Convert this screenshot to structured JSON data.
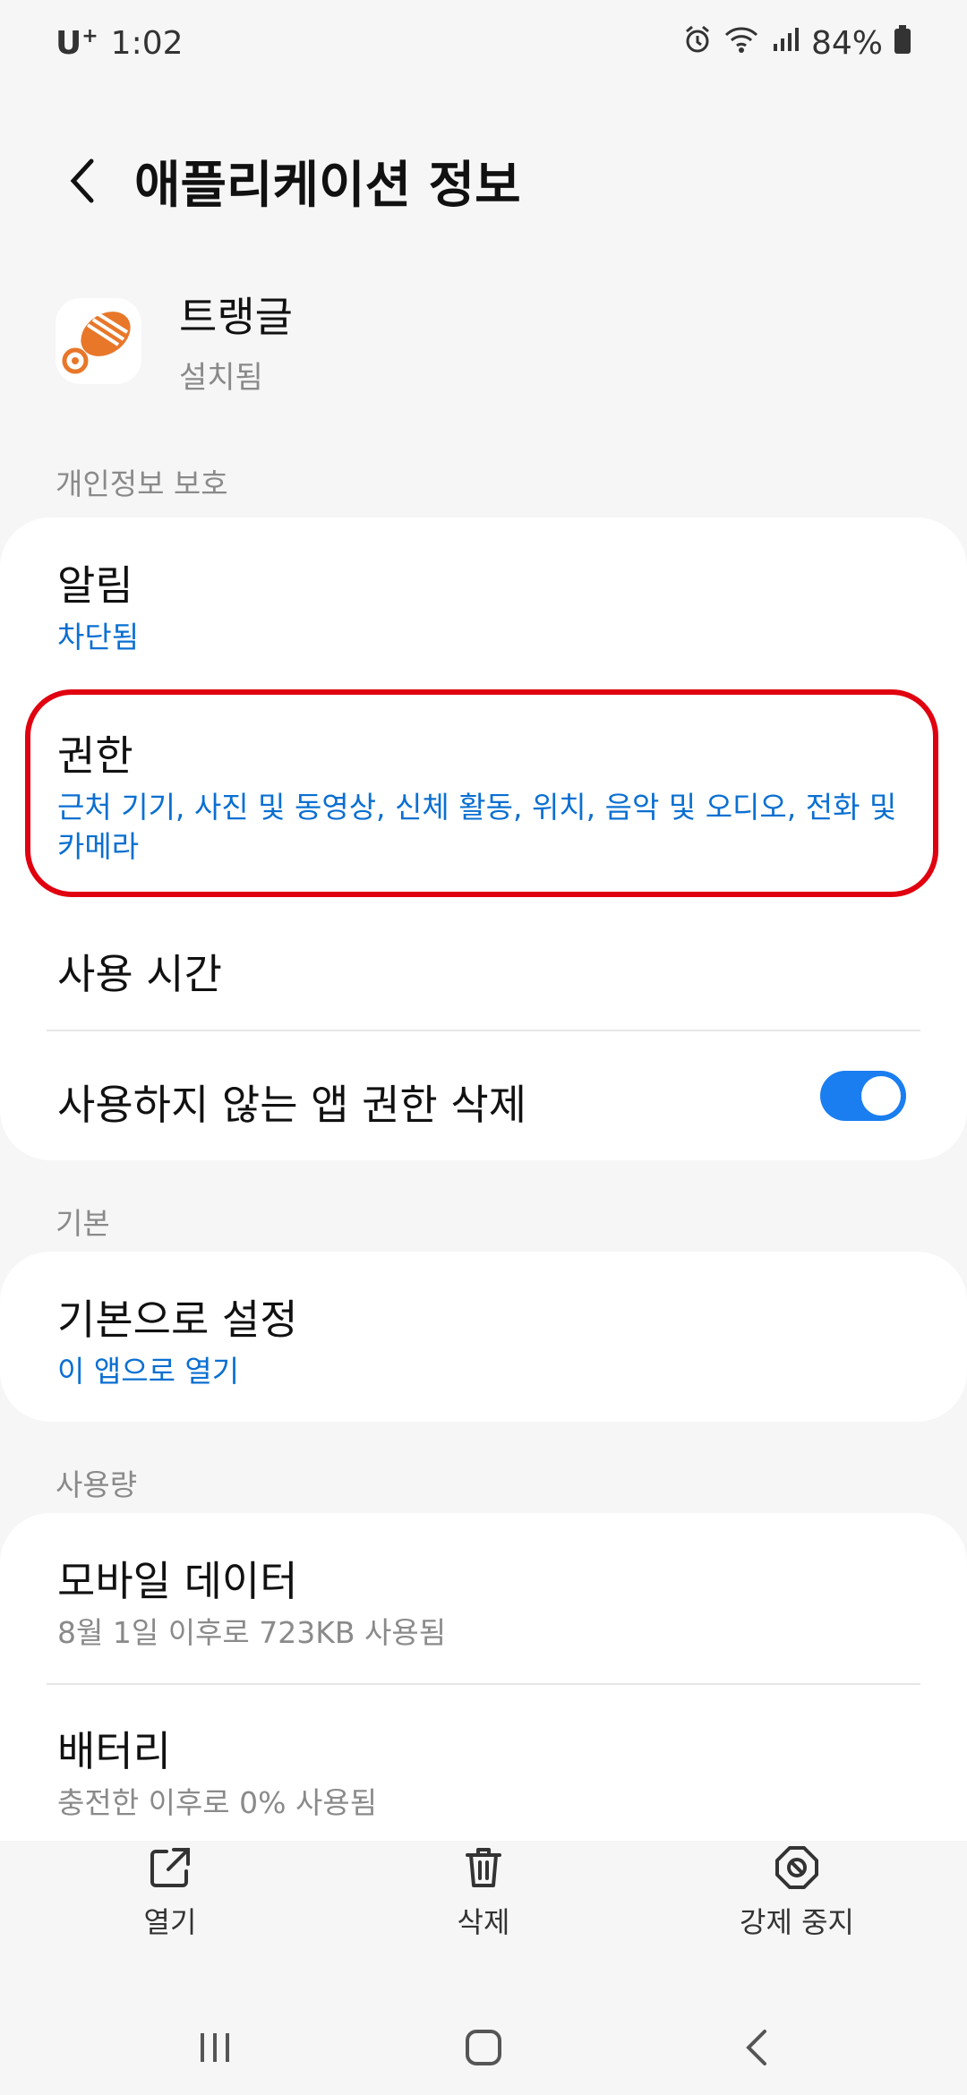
{
  "status_bar": {
    "carrier": "U",
    "carrier_sup": "+",
    "time": "1:02",
    "battery": "84%"
  },
  "header": {
    "title": "애플리케이션 정보"
  },
  "app": {
    "name": "트랭글",
    "status": "설치됨"
  },
  "sections": {
    "privacy": {
      "label": "개인정보 보호",
      "notifications": {
        "title": "알림",
        "value": "차단됨"
      },
      "permissions": {
        "title": "권한",
        "value": "근처 기기, 사진 및 동영상, 신체 활동, 위치, 음악 및 오디오, 전화 및 카메라"
      },
      "screen_time": {
        "title": "사용 시간"
      },
      "remove_permissions": {
        "title": "사용하지 않는 앱 권한 삭제",
        "toggle_on": true
      }
    },
    "default": {
      "label": "기본",
      "set_default": {
        "title": "기본으로 설정",
        "value": "이 앱으로 열기"
      }
    },
    "usage": {
      "label": "사용량",
      "mobile_data": {
        "title": "모바일 데이터",
        "value": "8월 1일 이후로 723KB 사용됨"
      },
      "battery": {
        "title": "배터리",
        "value": "충전한 이후로 0% 사용됨"
      }
    }
  },
  "bottom_actions": {
    "open": "열기",
    "uninstall": "삭제",
    "force_stop": "강제 중지"
  },
  "colors": {
    "accent": "#0a6fd1",
    "highlight": "#e0000f",
    "toggle": "#1a7ef0"
  }
}
